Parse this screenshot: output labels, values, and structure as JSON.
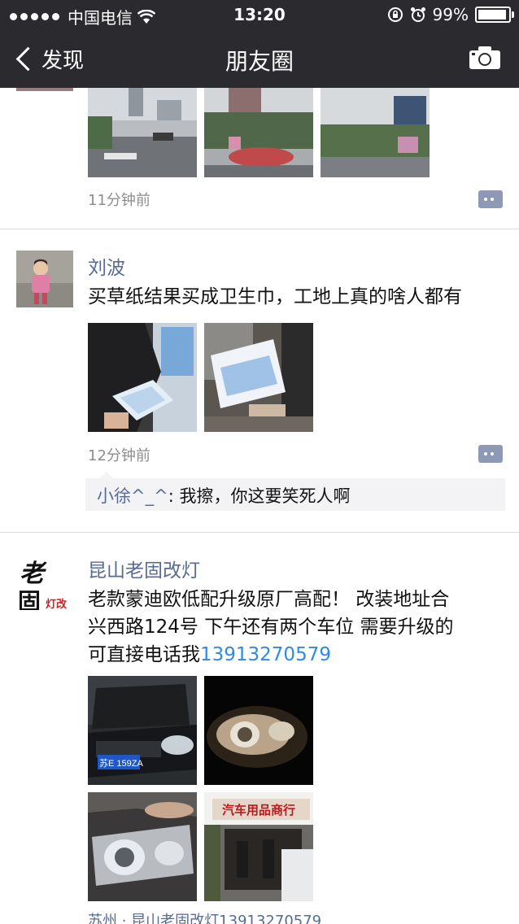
{
  "statusbar": {
    "carrier": "中国电信",
    "time": "13:20",
    "battery": "99%"
  },
  "navbar": {
    "back_label": "发现",
    "title": "朋友圈"
  },
  "posts": [
    {
      "time": "11分钟前"
    },
    {
      "author": "刘波",
      "text": "买草纸结果买成卫生巾，工地上真的啥人都有",
      "time": "12分钟前",
      "comment": {
        "name": "小徐^_^",
        "sep": ": ",
        "text": "我擦，你这要笑死人啊"
      }
    },
    {
      "author": "昆山老固改灯",
      "text_line1": "老款蒙迪欧低配升级原厂高配！ 改装地址合",
      "text_line2": "兴西路124号 下午还有两个车位 需要升级的",
      "text_line3_prefix": "可直接电话我",
      "phone": "13913270579",
      "logo_char1": "老",
      "logo_char2": "固",
      "logo_sub": "灯改",
      "shop_sign": "汽车用品商行",
      "plate": "苏E 159ZA",
      "location": "苏州 · 昆山老固改灯13913270579"
    }
  ]
}
